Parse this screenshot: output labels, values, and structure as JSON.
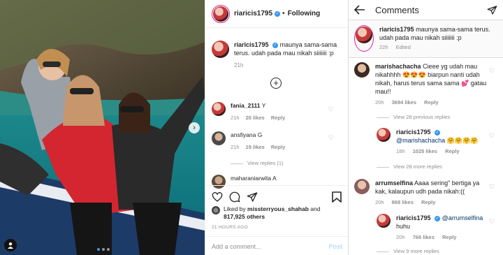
{
  "post": {
    "username": "riaricis1795",
    "follow_label": "Following",
    "caption": "maunya sama-sama terus. udah pada mau nikah siiiiiii :p",
    "caption_time": "21h",
    "comments": [
      {
        "user": "fania_2111",
        "text": "Y",
        "time": "21h",
        "likes": "20 likes",
        "reply": "Reply"
      },
      {
        "user": "ansfiyana",
        "text": "G",
        "time": "21h",
        "likes": "19 likes",
        "reply": "Reply"
      },
      {
        "user": "maharaniarwita",
        "text": "A",
        "time": "",
        "likes": "",
        "reply": ""
      }
    ],
    "view_replies": "View replies (1)",
    "liked_by_prefix": "Liked by",
    "liked_by_user": "missterryous_shahab",
    "liked_by_and": "and",
    "likes_count": "817,925 others",
    "time_ago": "21 HOURS AGO",
    "add_comment_placeholder": "Add a comment...",
    "post_label": "Post"
  },
  "comments_screen": {
    "title": "Comments",
    "caption": {
      "user": "riaricis1795",
      "text": "maunya sama-sama terus. udah pada mau nikah siiiiiii :p",
      "time": "22h",
      "status": "Edited"
    },
    "items": [
      {
        "user": "marishachacha",
        "text": "Cieee yg udah mau nikahhhh 😍😍😍 biarpun nanti udah nikah, harus terus sama sama 💕 gatau mau!!",
        "time": "20h",
        "likes": "3694 likes",
        "reply": "Reply"
      },
      {
        "view_previous": "View 28 previous replies"
      },
      {
        "user": "riaricis1795",
        "mention": "@marishachacha",
        "text": "🤗🤗🤗🤗",
        "time": "18h",
        "likes": "1025 likes",
        "reply": "Reply"
      },
      {
        "view_more": "View 28 more replies"
      },
      {
        "user": "arrumselfina",
        "text": "Aaaa sering\" bertiga ya kak, kalaupun udh pada nikah:((",
        "time": "20h",
        "likes": "868 likes",
        "reply": "Reply"
      },
      {
        "user": "riaricis1795",
        "mention": "@arrumselfina",
        "text": "huhu",
        "time": "20h",
        "likes": "766 likes",
        "reply": "Reply"
      },
      {
        "view_more2": "View 9 more replies"
      }
    ]
  },
  "colors": {
    "link": "#00376b",
    "verified": "#3897f0",
    "muted": "#8e8e8e"
  }
}
